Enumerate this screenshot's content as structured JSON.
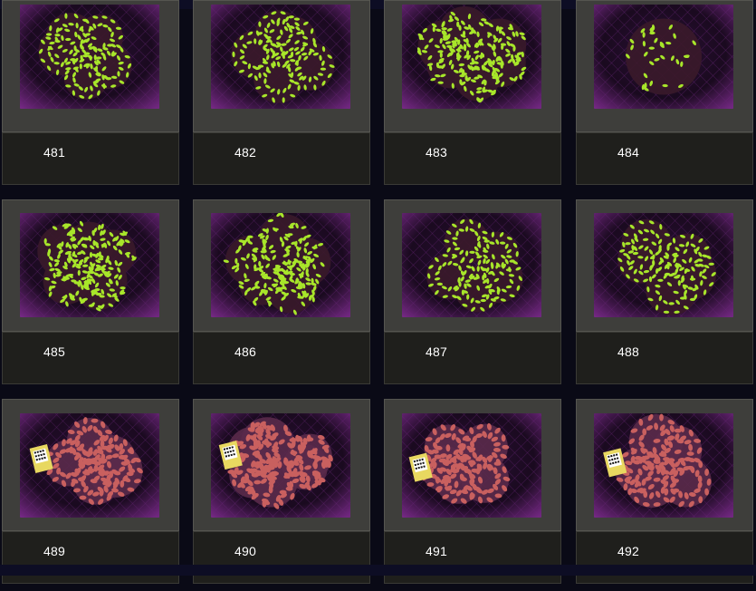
{
  "gallery": {
    "items": [
      {
        "label": "481",
        "variant": "green",
        "pattern": "rings"
      },
      {
        "label": "482",
        "variant": "green",
        "pattern": "rings"
      },
      {
        "label": "483",
        "variant": "green",
        "pattern": "dense"
      },
      {
        "label": "484",
        "variant": "green",
        "pattern": "blob"
      },
      {
        "label": "485",
        "variant": "green",
        "pattern": "dense"
      },
      {
        "label": "486",
        "variant": "green",
        "pattern": "dense"
      },
      {
        "label": "487",
        "variant": "green",
        "pattern": "rings"
      },
      {
        "label": "488",
        "variant": "green",
        "pattern": "rings"
      },
      {
        "label": "489",
        "variant": "pink",
        "pattern": "rings"
      },
      {
        "label": "490",
        "variant": "pink",
        "pattern": "dense"
      },
      {
        "label": "491",
        "variant": "pink",
        "pattern": "rings"
      },
      {
        "label": "492",
        "variant": "pink",
        "pattern": "rings"
      }
    ]
  },
  "colors": {
    "page_background": "#0a0a16",
    "frame": "#3e3e3b",
    "caption_box": "#1f1f1c",
    "caption_text": "#ffffff",
    "coral_green": "#a8e62a",
    "coral_pink": "#c9605f",
    "photo_background": "#1a0a1f",
    "photo_glow": "#7a2a8a"
  }
}
